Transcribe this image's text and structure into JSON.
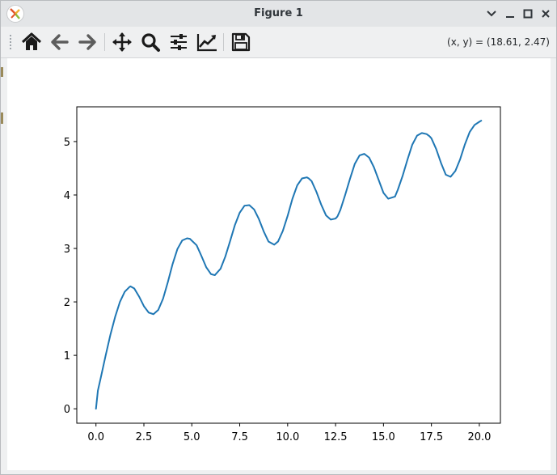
{
  "window": {
    "title": "Figure 1"
  },
  "toolbar": {
    "coords": "(x, y) = (18.61, 2.47)",
    "buttons": [
      "home-icon",
      "back-icon",
      "forward-icon",
      "pan-icon",
      "zoom-icon",
      "configure-icon",
      "edit-axes-icon",
      "save-icon"
    ]
  },
  "chart_data": {
    "type": "line",
    "title": "",
    "xlabel": "",
    "ylabel": "",
    "xlim": [
      -1.0,
      21.1
    ],
    "ylim": [
      -0.27,
      5.65
    ],
    "xticks": [
      0.0,
      2.5,
      5.0,
      7.5,
      10.0,
      12.5,
      15.0,
      17.5,
      20.0
    ],
    "xtick_labels": [
      "0.0",
      "2.5",
      "5.0",
      "7.5",
      "10.0",
      "12.5",
      "15.0",
      "17.5",
      "20.0"
    ],
    "yticks": [
      0,
      1,
      2,
      3,
      4,
      5
    ],
    "ytick_labels": [
      "0",
      "1",
      "2",
      "3",
      "4",
      "5"
    ],
    "grid": false,
    "series_color": "#1f77b4",
    "series": [
      {
        "x": [
          0.0,
          0.1,
          0.25,
          0.5,
          0.75,
          1.0,
          1.25,
          1.5,
          1.75,
          1.8,
          2.0,
          2.25,
          2.5,
          2.75,
          3.0,
          3.25,
          3.5,
          3.75,
          4.0,
          4.25,
          4.5,
          4.75,
          4.9,
          5.25,
          5.5,
          5.75,
          6.0,
          6.2,
          6.5,
          6.75,
          7.0,
          7.25,
          7.5,
          7.75,
          8.0,
          8.25,
          8.5,
          8.75,
          9.0,
          9.3,
          9.5,
          9.75,
          10.0,
          10.25,
          10.5,
          10.75,
          11.0,
          11.1,
          11.25,
          11.5,
          11.75,
          12.0,
          12.25,
          12.5,
          12.6,
          12.75,
          13.0,
          13.25,
          13.5,
          13.75,
          14.0,
          14.25,
          14.5,
          14.75,
          15.0,
          15.25,
          15.6,
          15.75,
          16.0,
          16.25,
          16.5,
          16.75,
          17.0,
          17.25,
          17.4,
          17.5,
          17.75,
          18.0,
          18.25,
          18.5,
          18.75,
          19.0,
          19.25,
          19.5,
          19.75,
          20.0,
          20.1
        ],
        "y": [
          0.0,
          0.34,
          0.58,
          0.99,
          1.38,
          1.72,
          2.0,
          2.19,
          2.28,
          2.29,
          2.25,
          2.1,
          1.92,
          1.8,
          1.77,
          1.85,
          2.06,
          2.37,
          2.71,
          2.99,
          3.15,
          3.19,
          3.18,
          3.06,
          2.86,
          2.65,
          2.52,
          2.5,
          2.62,
          2.85,
          3.14,
          3.44,
          3.67,
          3.8,
          3.81,
          3.73,
          3.55,
          3.32,
          3.13,
          3.07,
          3.13,
          3.33,
          3.61,
          3.93,
          4.18,
          4.31,
          4.33,
          4.31,
          4.26,
          4.06,
          3.82,
          3.62,
          3.54,
          3.56,
          3.6,
          3.72,
          4.0,
          4.3,
          4.58,
          4.74,
          4.77,
          4.7,
          4.52,
          4.28,
          4.04,
          3.93,
          3.97,
          4.1,
          4.36,
          4.66,
          4.94,
          5.11,
          5.16,
          5.14,
          5.1,
          5.06,
          4.86,
          4.6,
          4.38,
          4.34,
          4.45,
          4.67,
          4.95,
          5.18,
          5.31,
          5.37,
          5.39
        ]
      }
    ]
  }
}
